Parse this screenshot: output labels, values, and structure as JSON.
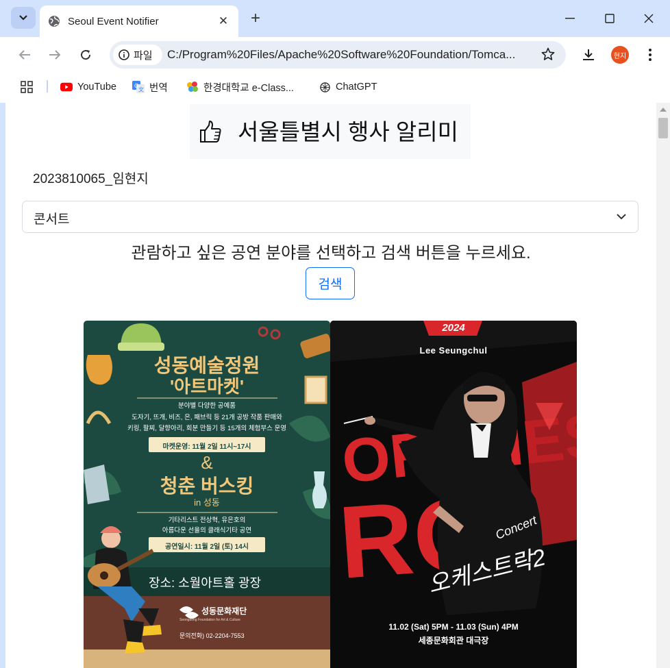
{
  "browser": {
    "tab_title": "Seoul Event Notifier",
    "url_chip": "파일",
    "url": "C:/Program%20Files/Apache%20Software%20Foundation/Tomca...",
    "profile_label": "현지",
    "bookmarks": [
      {
        "label": "YouTube",
        "icon": "youtube-icon"
      },
      {
        "label": "번역",
        "icon": "translate-icon"
      },
      {
        "label": "한경대학교 e-Class...",
        "icon": "hands-icon"
      },
      {
        "label": "ChatGPT",
        "icon": "chatgpt-icon"
      }
    ]
  },
  "page": {
    "title": "서울틀별시 행사 알리미",
    "student": "2023810065_임현지",
    "category_selected": "콘서트",
    "instruction": "관람하고 싶은 공연 분야를 선택하고 검색 버튼을 누르세요.",
    "search_button": "검색"
  },
  "posters": [
    {
      "title_line1": "성동예술정원",
      "title_line2": "'아트마켓'",
      "desc1": "분야별 다양한 공예품",
      "desc2": "도자기, 뜨개, 비즈, 은, 패브릭 등 21개 공방 작품 판매와",
      "desc3": "키링, 팔찌, 달향아리, 회분 만들기 등 15개의 체험부스 운영",
      "market_time": "마켓운영: 11월 2일 11시~17시",
      "amp": "&",
      "busking_title": "청춘 버스킹",
      "busking_sub": "in 성동",
      "busking_desc1": "기타리스트 전상혁, 유은호의",
      "busking_desc2": "아름다운 선율의 클래식기타 공연",
      "perform_time": "공연일시: 11월 2일 (토) 14시",
      "place": "장소:  소월아트홀 광장",
      "org": "성동문화재단",
      "org_sub": "Seongdong Foundation for Art & Culture",
      "contact": "문의전화) 02-2204-7553"
    },
    {
      "year": "2024",
      "artist": "Lee Seungchul",
      "big_text_top": "ORCHESTRA",
      "big_text_mid": "RO",
      "script_title": "오케스트락2",
      "concert_word": "Concert",
      "dates": "11.02 (Sat) 5PM - 11.03 (Sun) 4PM",
      "venue": "세종문화회관 대극장"
    }
  ]
}
